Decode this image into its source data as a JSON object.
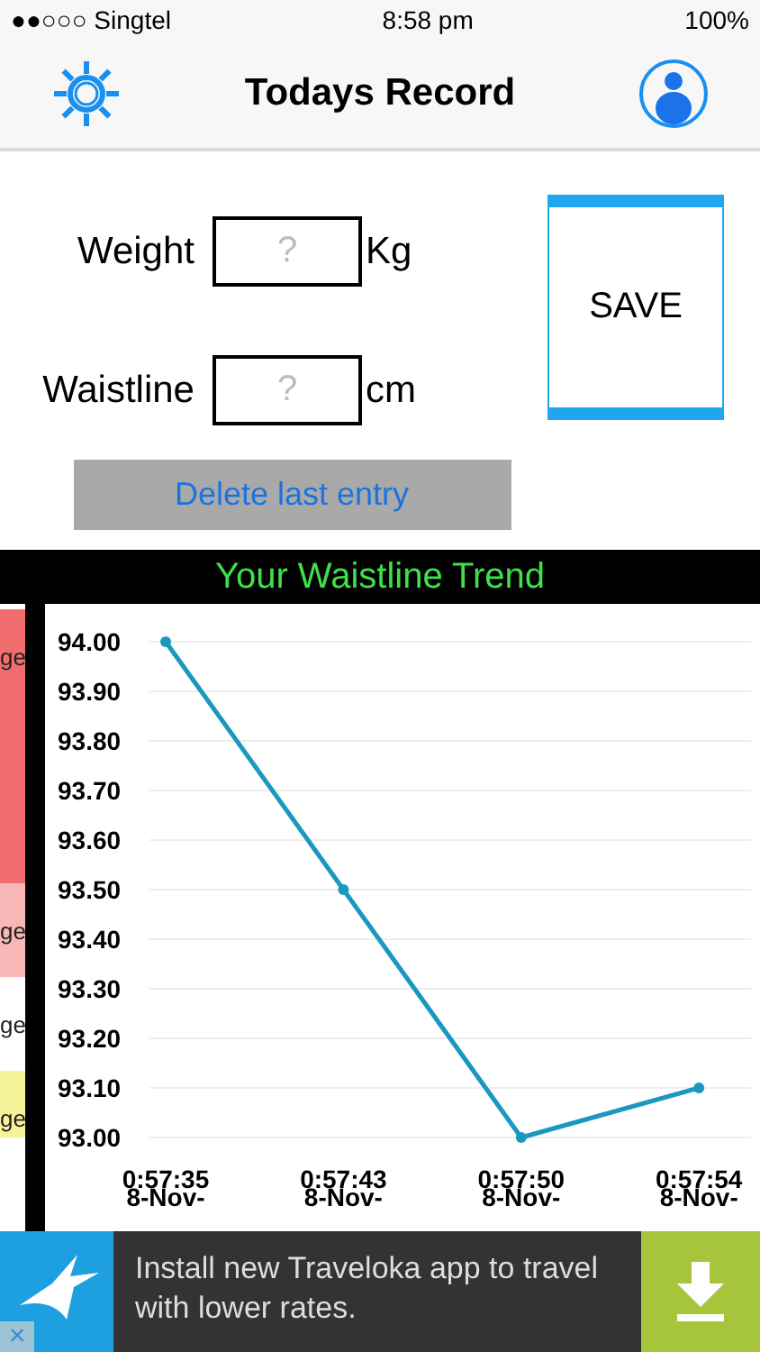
{
  "status_bar": {
    "carrier": "●●○○○ Singtel",
    "time": "8:58 pm",
    "battery": "100%"
  },
  "nav": {
    "title": "Todays Record"
  },
  "form": {
    "fields": [
      {
        "label": "Weight",
        "placeholder": "?",
        "unit": "Kg"
      },
      {
        "label": "Waistline",
        "placeholder": "?",
        "unit": "cm"
      }
    ],
    "save": "SAVE",
    "delete": "Delete last entry"
  },
  "chart_title": "Your Waistline Trend",
  "side_strip": [
    {
      "text": "ge",
      "color": "#f26d6d"
    },
    {
      "text": "ge",
      "color": "#f8b8b8"
    },
    {
      "text": "ge",
      "color": "#ffffff"
    },
    {
      "text": "ge",
      "color": "#f7f39a"
    }
  ],
  "chart_data": {
    "type": "line",
    "categories": [
      "0:57:35 8-Nov-",
      "0:57:43 8-Nov-",
      "0:57:50 8-Nov-",
      "0:57:54 8-Nov-"
    ],
    "grid": true,
    "series": [
      {
        "color": "#1a98c0",
        "marker": true,
        "values": [
          94.0,
          93.5,
          93.0,
          93.1
        ]
      }
    ],
    "ylim": [
      93.0,
      94.0
    ],
    "yticks": [
      {
        "value": 94.0,
        "label": "94.00"
      },
      {
        "value": 93.9,
        "label": "93.90"
      },
      {
        "value": 93.8,
        "label": "93.80"
      },
      {
        "value": 93.7,
        "label": "93.70"
      },
      {
        "value": 93.6,
        "label": "93.60"
      },
      {
        "value": 93.5,
        "label": "93.50"
      },
      {
        "value": 93.4,
        "label": "93.40"
      },
      {
        "value": 93.3,
        "label": "93.30"
      },
      {
        "value": 93.2,
        "label": "93.20"
      },
      {
        "value": 93.1,
        "label": "93.10"
      },
      {
        "value": 93.0,
        "label": "93.00"
      }
    ]
  },
  "ad": {
    "text": "Install new Traveloka app to travel with lower rates.",
    "close": "×"
  }
}
